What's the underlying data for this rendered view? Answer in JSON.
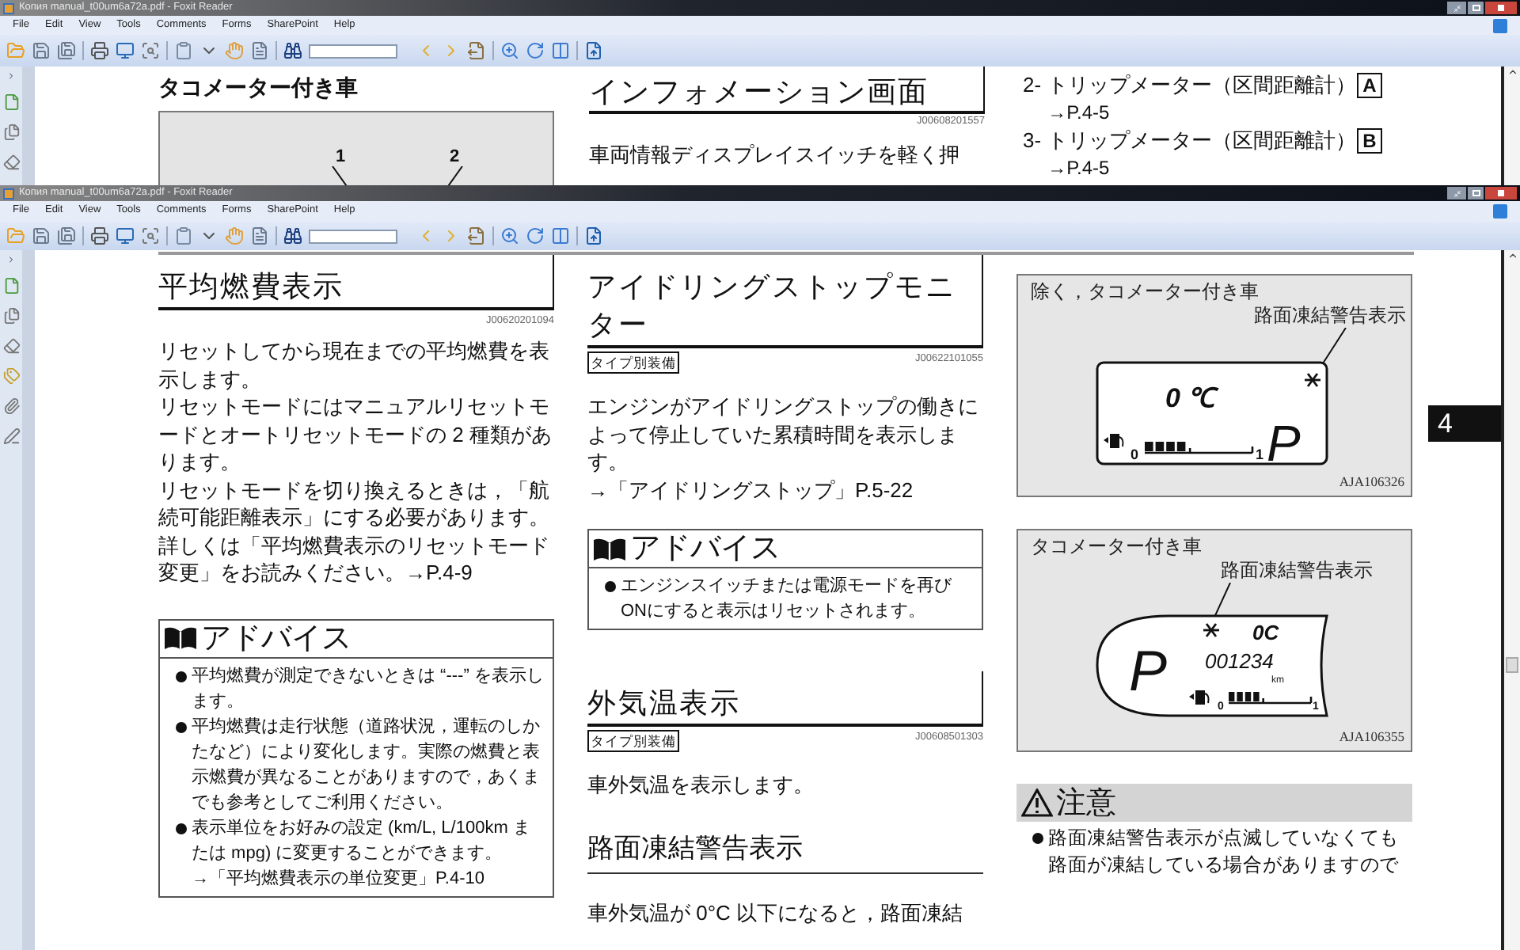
{
  "back_window": {
    "title": "Копия manual_t00um6a72a.pdf - Foxit Reader",
    "menu": [
      "File",
      "Edit",
      "View",
      "Tools",
      "Comments",
      "Forms",
      "SharePoint",
      "Help"
    ],
    "page": {
      "figure": {
        "heading": "タコメーター付き車",
        "callouts": [
          "1",
          "2"
        ]
      },
      "section": {
        "heading": "インフォメーション画面",
        "code": "J00608201557",
        "paragraph": "車両情報ディスプレイスイッチを軽く押"
      },
      "list": [
        {
          "number": "2-",
          "text": "トリップメーター（区間距離計）",
          "key": "A",
          "ref": "→P.4-5"
        },
        {
          "number": "3-",
          "text": "トリップメーター（区間距離計）",
          "key": "B",
          "ref": "→P.4-5"
        }
      ]
    }
  },
  "front_window": {
    "title": "Копия manual_t00um6a72a.pdf - Foxit Reader",
    "menu": [
      "File",
      "Edit",
      "View",
      "Tools",
      "Comments",
      "Forms",
      "SharePoint",
      "Help"
    ],
    "page": {
      "columns": [
        {
          "sections": [
            {
              "kind": "section",
              "heading": "平均燃費表示",
              "code": "J00620201094",
              "paragraphs": [
                "リセットしてから現在までの平均燃費を表示します。",
                "リセットモードにはマニュアルリセットモードとオートリセットモードの 2 種類があります。",
                "リセットモードを切り換えるときは，「航続可能距離表示」にする必要があります。詳しくは「平均燃費表示のリセットモード変更」をお読みください。→P.4-9"
              ],
              "advice": {
                "title": "アドバイス",
                "items": [
                  {
                    "text": "平均燃費が測定できないときは “---” を表示します。"
                  },
                  {
                    "text": "平均燃費は走行状態（道路状況，運転のしかたなど）により変化します。実際の燃費と表示燃費が異なることがありますので，あくまでも参考としてご利用ください。"
                  },
                  {
                    "text": "表示単位をお好みの設定 (km/L, L/100km または mpg) に変更することができます。",
                    "ref": "→「平均燃費表示の単位変更」P.4-10"
                  }
                ]
              }
            }
          ]
        },
        {
          "sections": [
            {
              "kind": "section",
              "heading": "アイドリングストップモニター",
              "tag": "タイプ別装備",
              "code": "J00622101055",
              "paragraphs": [
                "エンジンがアイドリングストップの働きによって停止していた累積時間を表示します。",
                "→「アイドリングストップ」P.5-22"
              ],
              "advice": {
                "title": "アドバイス",
                "items": [
                  {
                    "text": "エンジンスイッチまたは電源モードを再びONにすると表示はリセットされます。"
                  }
                ]
              }
            },
            {
              "kind": "section",
              "heading": "外気温表示",
              "tag": "タイプ別装備",
              "code": "J00608501303",
              "paragraphs": [
                "車外気温を表示します。"
              ]
            },
            {
              "kind": "subsection",
              "heading": "路面凍結警告表示",
              "paragraphs": [
                "車外気温が 0°C 以下になると，路面凍結"
              ]
            }
          ]
        }
      ],
      "figures": [
        {
          "kind": "box_lcd",
          "label": "除く，タコメーター付き車",
          "callout": "路面凍結警告表示",
          "code": "AJA106326",
          "temperature": "0 ℃",
          "gear": "P",
          "gauge_min": "0",
          "gauge_max": "1"
        },
        {
          "kind": "wide_lcd",
          "label": "タコメーター付き車",
          "callout": "路面凍結警告表示",
          "code": "AJA106355",
          "temperature": "0C",
          "gear": "P",
          "odometer": "001234",
          "unit": "km",
          "gauge_min": "0",
          "gauge_max": "1"
        }
      ],
      "caution": {
        "title": "注意",
        "items": [
          "路面凍結警告表示が点滅していなくても路面が凍結している場合がありますので"
        ]
      },
      "side_tab": "4"
    }
  }
}
